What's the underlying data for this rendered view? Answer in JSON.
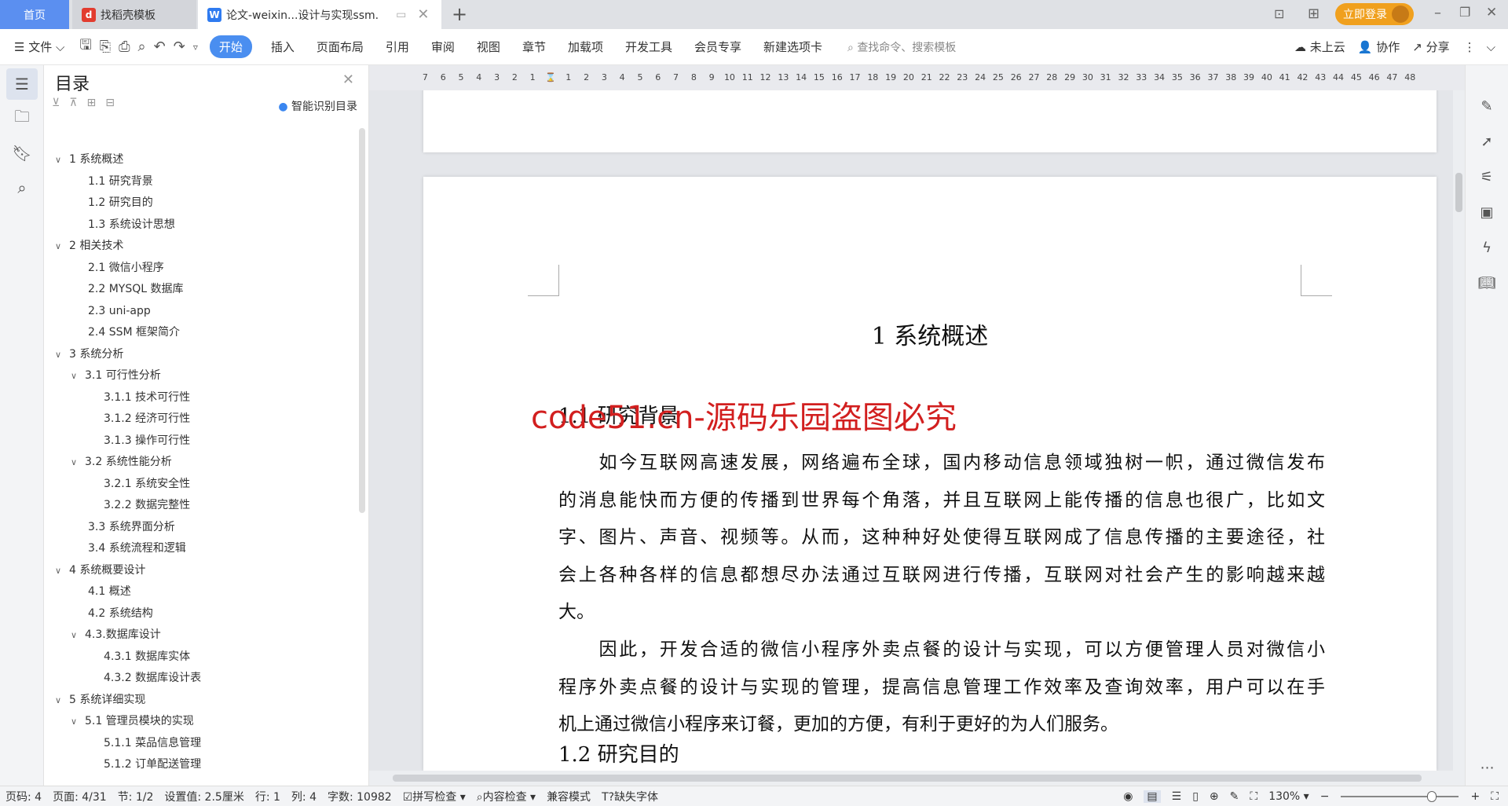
{
  "tabs": [
    {
      "label": "首页",
      "active": false
    },
    {
      "label": "找稻壳模板",
      "icon": "docer-icon"
    },
    {
      "label": "论文-weixin...设计与实现ssm.",
      "icon": "wps-writer-icon",
      "active": true
    }
  ],
  "window": {
    "login_label": "立即登录",
    "accent": "#f0a01e"
  },
  "toolbar": {
    "file_label": "文件",
    "items": [
      "开始",
      "插入",
      "页面布局",
      "引用",
      "审阅",
      "视图",
      "章节",
      "加载项",
      "开发工具",
      "会员专享",
      "新建选项卡"
    ],
    "active": "开始",
    "search_placeholder": "查找命令、搜索模板",
    "cloud_label": "未上云",
    "collab_label": "协作",
    "share_label": "分享"
  },
  "sidebar": {
    "title": "目录",
    "smart_label": "智能识别目录",
    "toc": [
      {
        "label": "1 系统概述",
        "level": 1,
        "expanded": true
      },
      {
        "label": "1.1  研究背景",
        "level": 2
      },
      {
        "label": "1.2 研究目的",
        "level": 2
      },
      {
        "label": "1.3 系统设计思想",
        "level": 2
      },
      {
        "label": "2 相关技术",
        "level": 1,
        "expanded": true
      },
      {
        "label": "2.1 微信小程序",
        "level": 2
      },
      {
        "label": "2.2 MYSQL 数据库",
        "level": 2
      },
      {
        "label": "2.3 uni-app",
        "level": 2
      },
      {
        "label": "2.4 SSM 框架简介",
        "level": 2
      },
      {
        "label": "3 系统分析",
        "level": 1,
        "expanded": true
      },
      {
        "label": "3.1 可行性分析",
        "level": 2,
        "expanded": true
      },
      {
        "label": "3.1.1 技术可行性",
        "level": 3
      },
      {
        "label": "3.1.2 经济可行性",
        "level": 3
      },
      {
        "label": "3.1.3 操作可行性",
        "level": 3
      },
      {
        "label": "3.2 系统性能分析",
        "level": 2,
        "expanded": true
      },
      {
        "label": "3.2.1  系统安全性",
        "level": 3
      },
      {
        "label": "3.2.2  数据完整性",
        "level": 3
      },
      {
        "label": "3.3 系统界面分析",
        "level": 2
      },
      {
        "label": "3.4 系统流程和逻辑",
        "level": 2
      },
      {
        "label": "4 系统概要设计",
        "level": 1,
        "expanded": true
      },
      {
        "label": "4.1 概述",
        "level": 2
      },
      {
        "label": "4.2 系统结构",
        "level": 2
      },
      {
        "label": "4.3.数据库设计",
        "level": 2,
        "expanded": true
      },
      {
        "label": "4.3.1 数据库实体",
        "level": 3
      },
      {
        "label": "4.3.2 数据库设计表",
        "level": 3
      },
      {
        "label": "5 系统详细实现",
        "level": 1,
        "expanded": true
      },
      {
        "label": "5.1  管理员模块的实现",
        "level": 2,
        "expanded": true
      },
      {
        "label": "5.1.1  菜品信息管理",
        "level": 3
      },
      {
        "label": "5.1.2  订单配送管理",
        "level": 3
      }
    ]
  },
  "ruler": {
    "ticks": [
      "7",
      "6",
      "5",
      "4",
      "3",
      "2",
      "1",
      "",
      "1",
      "2",
      "3",
      "4",
      "5",
      "6",
      "7",
      "8",
      "9",
      "10",
      "11",
      "12",
      "13",
      "14",
      "15",
      "16",
      "17",
      "18",
      "19",
      "20",
      "21",
      "22",
      "23",
      "24",
      "25",
      "26",
      "27",
      "28",
      "29",
      "30",
      "31",
      "32",
      "33",
      "34",
      "35",
      "36",
      "37",
      "38",
      "39",
      "40",
      "41",
      "42",
      "43",
      "44",
      "45",
      "46",
      "47",
      "48"
    ]
  },
  "document": {
    "heading1": "1 系统概述",
    "heading2": "1.1  研究背景",
    "watermark": "code51.cn-源码乐园盗图必究",
    "para1": [
      "　　如今互联网高速发展，网络遍布全球，国内移动信息领域独树一帜，通过微信发布",
      "的消息能快而方便的传播到世界每个角落，并且互联网上能传播的信息也很广，比如文",
      "字、图片、声音、视频等。从而，这种种好处使得互联网成了信息传播的主要途径，社",
      "会上各种各样的信息都想尽办法通过互联网进行传播，互联网对社会产生的影响越来越",
      "大。"
    ],
    "para2": [
      "　　因此，开发合适的微信小程序外卖点餐的设计与实现，可以方便管理人员对微信小",
      "程序外卖点餐的设计与实现的管理，提高信息管理工作效率及查询效率，用户可以在手",
      "机上通过微信小程序来订餐，更加的方便，有利于更好的为人们服务。"
    ],
    "heading3": "1.2 研究目的"
  },
  "status": {
    "page_code": "页码: 4",
    "page": "页面: 4/31",
    "section": "节: 1/2",
    "setting": "设置值: 2.5厘米",
    "row": "行: 1",
    "col": "列: 4",
    "wordcount": "字数: 10982",
    "spell": "拼写检查",
    "content_check": "内容检查",
    "compat": "兼容模式",
    "missing_font": "缺失字体",
    "zoom": "130%",
    "zoom_percent": 130
  }
}
